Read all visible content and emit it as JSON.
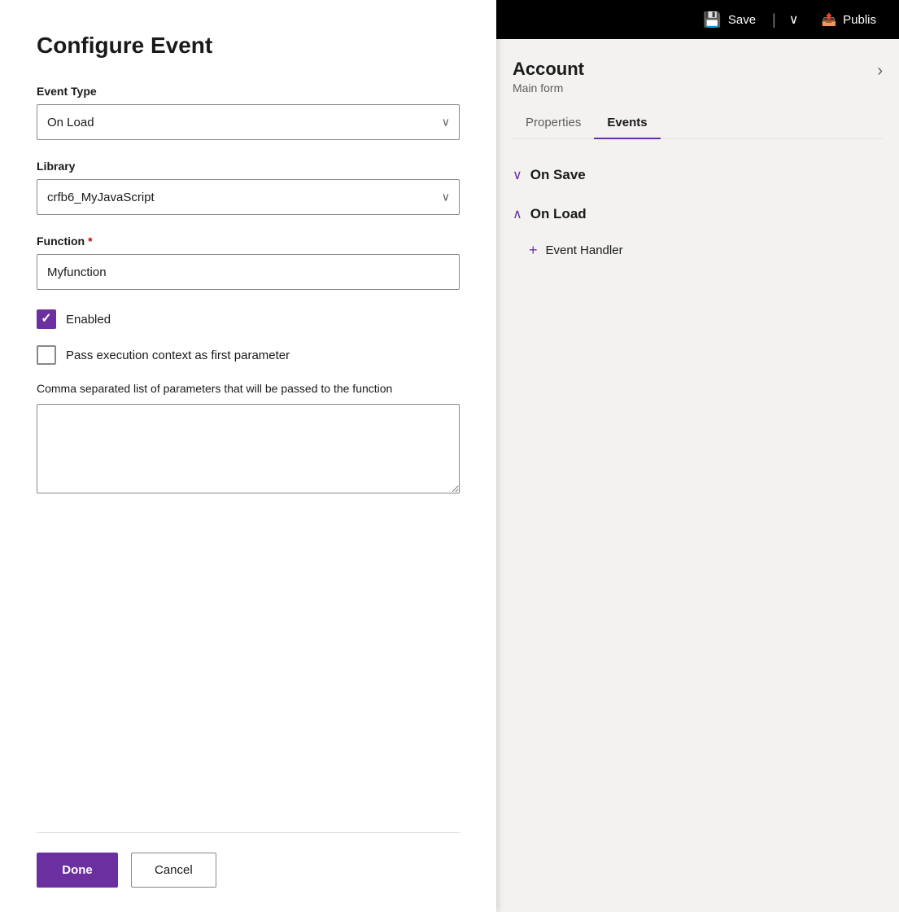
{
  "dialog": {
    "title": "Configure Event",
    "event_type_label": "Event Type",
    "event_type_value": "On Load",
    "library_label": "Library",
    "library_value": "crfb6_MyJavaScript",
    "function_label": "Function",
    "function_required": true,
    "function_value": "Myfunction",
    "enabled_label": "Enabled",
    "enabled_checked": true,
    "pass_context_label": "Pass execution context as first parameter",
    "pass_context_checked": false,
    "params_label": "Comma separated list of parameters that will be passed to the function",
    "params_value": "",
    "done_label": "Done",
    "cancel_label": "Cancel"
  },
  "topbar": {
    "save_label": "Save",
    "publish_label": "Publis"
  },
  "sidebar": {
    "account_title": "Account",
    "account_subtitle": "Main form",
    "tab_properties": "Properties",
    "tab_events": "Events",
    "on_save_label": "On Save",
    "on_load_label": "On Load",
    "event_handler_label": "Event Handler"
  },
  "icons": {
    "chevron_down": "∨",
    "chevron_right": "›",
    "chevron_up": "∧",
    "checkmark": "✓",
    "plus": "+",
    "save": "💾",
    "publish": "📤",
    "dropdown": "⌄"
  }
}
